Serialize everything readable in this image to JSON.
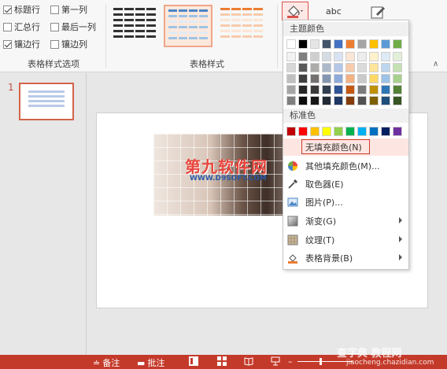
{
  "ribbon": {
    "options": [
      {
        "label": "标题行",
        "checked": true
      },
      {
        "label": "第一列",
        "checked": false
      },
      {
        "label": "汇总行",
        "checked": false
      },
      {
        "label": "最后一列",
        "checked": false
      },
      {
        "label": "镶边行",
        "checked": true
      },
      {
        "label": "镶边列",
        "checked": false
      }
    ],
    "options_group_label": "表格样式选项",
    "styles_group_label": "表格样式",
    "abc_label": "abc",
    "collapse_glyph": "∧",
    "shading_icon": "paint-bucket-icon",
    "pen_icon": "pen-icon"
  },
  "slide_pane": {
    "slide_number": "1"
  },
  "canvas": {
    "watermark_main": "第九软件网",
    "watermark_url": "WWW.D9SOFT.COM"
  },
  "menu": {
    "theme_colors_label": "主题颜色",
    "standard_colors_label": "标准色",
    "theme_top": [
      "#ffffff",
      "#000000",
      "#e7e6e6",
      "#44546a",
      "#4472c4",
      "#ed7d31",
      "#a5a5a5",
      "#ffc000",
      "#5b9bd5",
      "#70ad47"
    ],
    "theme_shades": [
      [
        "#f2f2f2",
        "#7f7f7f",
        "#d0cece",
        "#d6dce4",
        "#d9e2f3",
        "#fbe5d5",
        "#ededed",
        "#fff2cc",
        "#deebf6",
        "#e2efd9"
      ],
      [
        "#d8d8d8",
        "#595959",
        "#aeabab",
        "#adb9ca",
        "#b4c6e7",
        "#f7cbac",
        "#dbdbdb",
        "#fee599",
        "#bdd7ee",
        "#c5e0b3"
      ],
      [
        "#bfbfbf",
        "#3f3f3f",
        "#757070",
        "#8496b0",
        "#8eaadb",
        "#f4b183",
        "#c9c9c9",
        "#ffd965",
        "#9cc3e5",
        "#a8d08d"
      ],
      [
        "#a5a5a5",
        "#262626",
        "#3a3838",
        "#323f4f",
        "#2f5496",
        "#c45911",
        "#7b7b7b",
        "#bf9000",
        "#2e75b5",
        "#538135"
      ],
      [
        "#7f7f7f",
        "#0c0c0c",
        "#171616",
        "#222a35",
        "#1f3864",
        "#833c0b",
        "#525252",
        "#7f6000",
        "#1e4e79",
        "#375623"
      ]
    ],
    "standard_colors": [
      "#c00000",
      "#ff0000",
      "#ffc000",
      "#ffff00",
      "#92d050",
      "#00b050",
      "#00b0f0",
      "#0070c0",
      "#002060",
      "#7030a0"
    ],
    "items": [
      {
        "label": "无填充颜色(N)",
        "icon": "",
        "submenu": false
      },
      {
        "label": "其他填充颜色(M)...",
        "icon": "color-wheel-icon",
        "submenu": false
      },
      {
        "label": "取色器(E)",
        "icon": "eyedropper-icon",
        "submenu": false
      },
      {
        "label": "图片(P)...",
        "icon": "picture-icon",
        "submenu": false
      },
      {
        "label": "渐变(G)",
        "icon": "gradient-icon",
        "submenu": true
      },
      {
        "label": "纹理(T)",
        "icon": "texture-icon",
        "submenu": true
      },
      {
        "label": "表格背景(B)",
        "icon": "table-background-icon",
        "submenu": true
      }
    ]
  },
  "statusbar": {
    "notes_label": "备注",
    "comments_label": "批注",
    "site_main": "查字典 教程网",
    "site_url": "jiaocheng.chazidian.com"
  },
  "colors": {
    "accent_red": "#c43a2a",
    "highlight": "#fde6e1",
    "table_style_blue": "#5b9bd5",
    "table_style_orange": "#ed7d31"
  }
}
